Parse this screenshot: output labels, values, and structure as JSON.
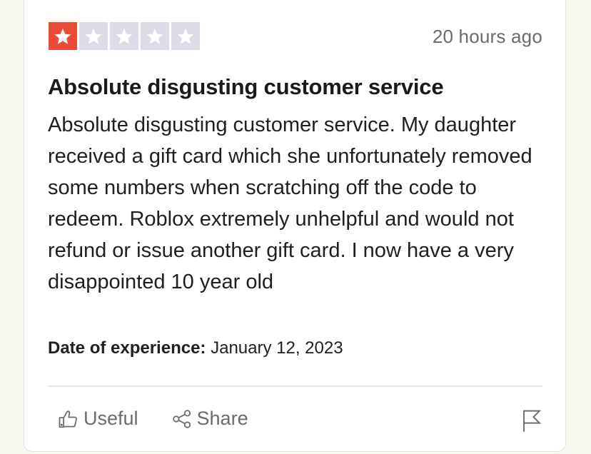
{
  "review": {
    "rating": 1,
    "max_rating": 5,
    "rating_color": "#ea4b36",
    "empty_star_color": "#dcdce6",
    "timestamp": "20 hours ago",
    "title": "Absolute disgusting customer service",
    "body": "Absolute disgusting customer service. My daughter received a gift card which she unfortunately removed some numbers when scratching off the code to redeem. Roblox extremely unhelpful and would not refund or issue another gift card. I now have a very disappointed 10 year old",
    "date_of_experience_label": "Date of experience:",
    "date_of_experience_value": "January 12, 2023"
  },
  "actions": {
    "useful_label": "Useful",
    "useful_icon": "thumbs-up-icon",
    "share_label": "Share",
    "share_icon": "share-icon",
    "report_icon": "flag-icon"
  }
}
